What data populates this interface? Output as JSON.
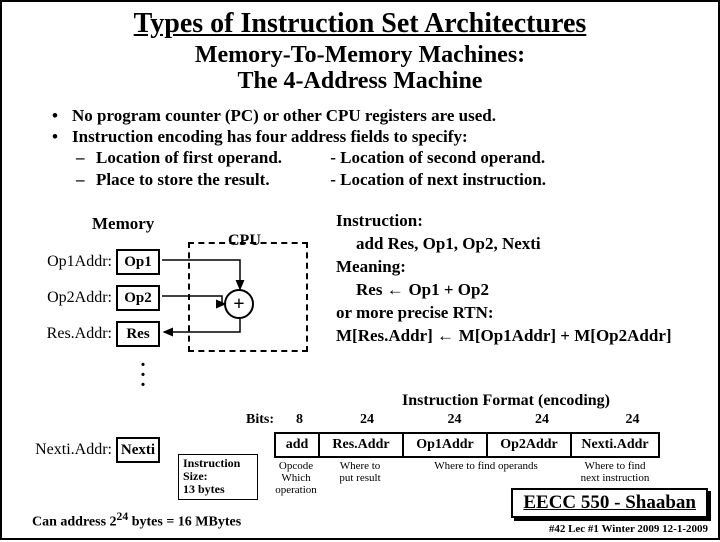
{
  "title": "Types of Instruction Set Architectures",
  "subtitle_l1": "Memory-To-Memory Machines:",
  "subtitle_l2": "The 4-Address Machine",
  "bullets": {
    "b1": "No program counter (PC) or other CPU registers are used.",
    "b2": "Instruction encoding has four address fields to specify:",
    "b2a": "Location of first operand.",
    "b2a2": "- Location of second operand.",
    "b2b": "Place to store the result.",
    "b2b2": "- Location of next instruction."
  },
  "labels": {
    "memory": "Memory",
    "cpu": "CPU",
    "adder": "+"
  },
  "mem": {
    "r0": {
      "addr": "Op1Addr:",
      "val": "Op1"
    },
    "r1": {
      "addr": "Op2Addr:",
      "val": "Op2"
    },
    "r2": {
      "addr": "Res.Addr:",
      "val": "Res"
    },
    "r3": {
      "addr": "Nexti.Addr:",
      "val": "Nexti"
    }
  },
  "right": {
    "l0": "Instruction:",
    "l1": "add Res, Op1, Op2, Nexti",
    "l2": "Meaning:",
    "l3a": "Res",
    "l3b": "Op1 + Op2",
    "l4": "or more precise RTN:",
    "l5a": "M[Res.Addr]",
    "l5b": "M[Op1Addr] + M[Op2Addr]"
  },
  "fmt_title": "Instruction Format (encoding)",
  "bits": {
    "label": "Bits:",
    "b0": "8",
    "b1": "24",
    "b2": "24",
    "b3": "24",
    "b4": "24"
  },
  "fields": {
    "f0": "add",
    "f1": "Res.Addr",
    "f2": "Op1Addr",
    "f3": "Op2Addr",
    "f4": "Nexti.Addr"
  },
  "desc": {
    "d0a": "Opcode",
    "d0b": "Which",
    "d0c": "operation",
    "d1a": "Where to",
    "d1b": "put result",
    "d23": "Where to find operands",
    "d4a": "Where to find",
    "d4b": "next instruction"
  },
  "isize": {
    "l1": "Instruction",
    "l2": "Size:",
    "l3": "13 bytes"
  },
  "bottom": {
    "pre": "Can address 2",
    "exp": "24",
    "post": " bytes = 16 MBytes"
  },
  "footer": {
    "course": "EECC 550 - Shaaban",
    "meta": "#42   Lec #1  Winter 2009  12-1-2009"
  }
}
